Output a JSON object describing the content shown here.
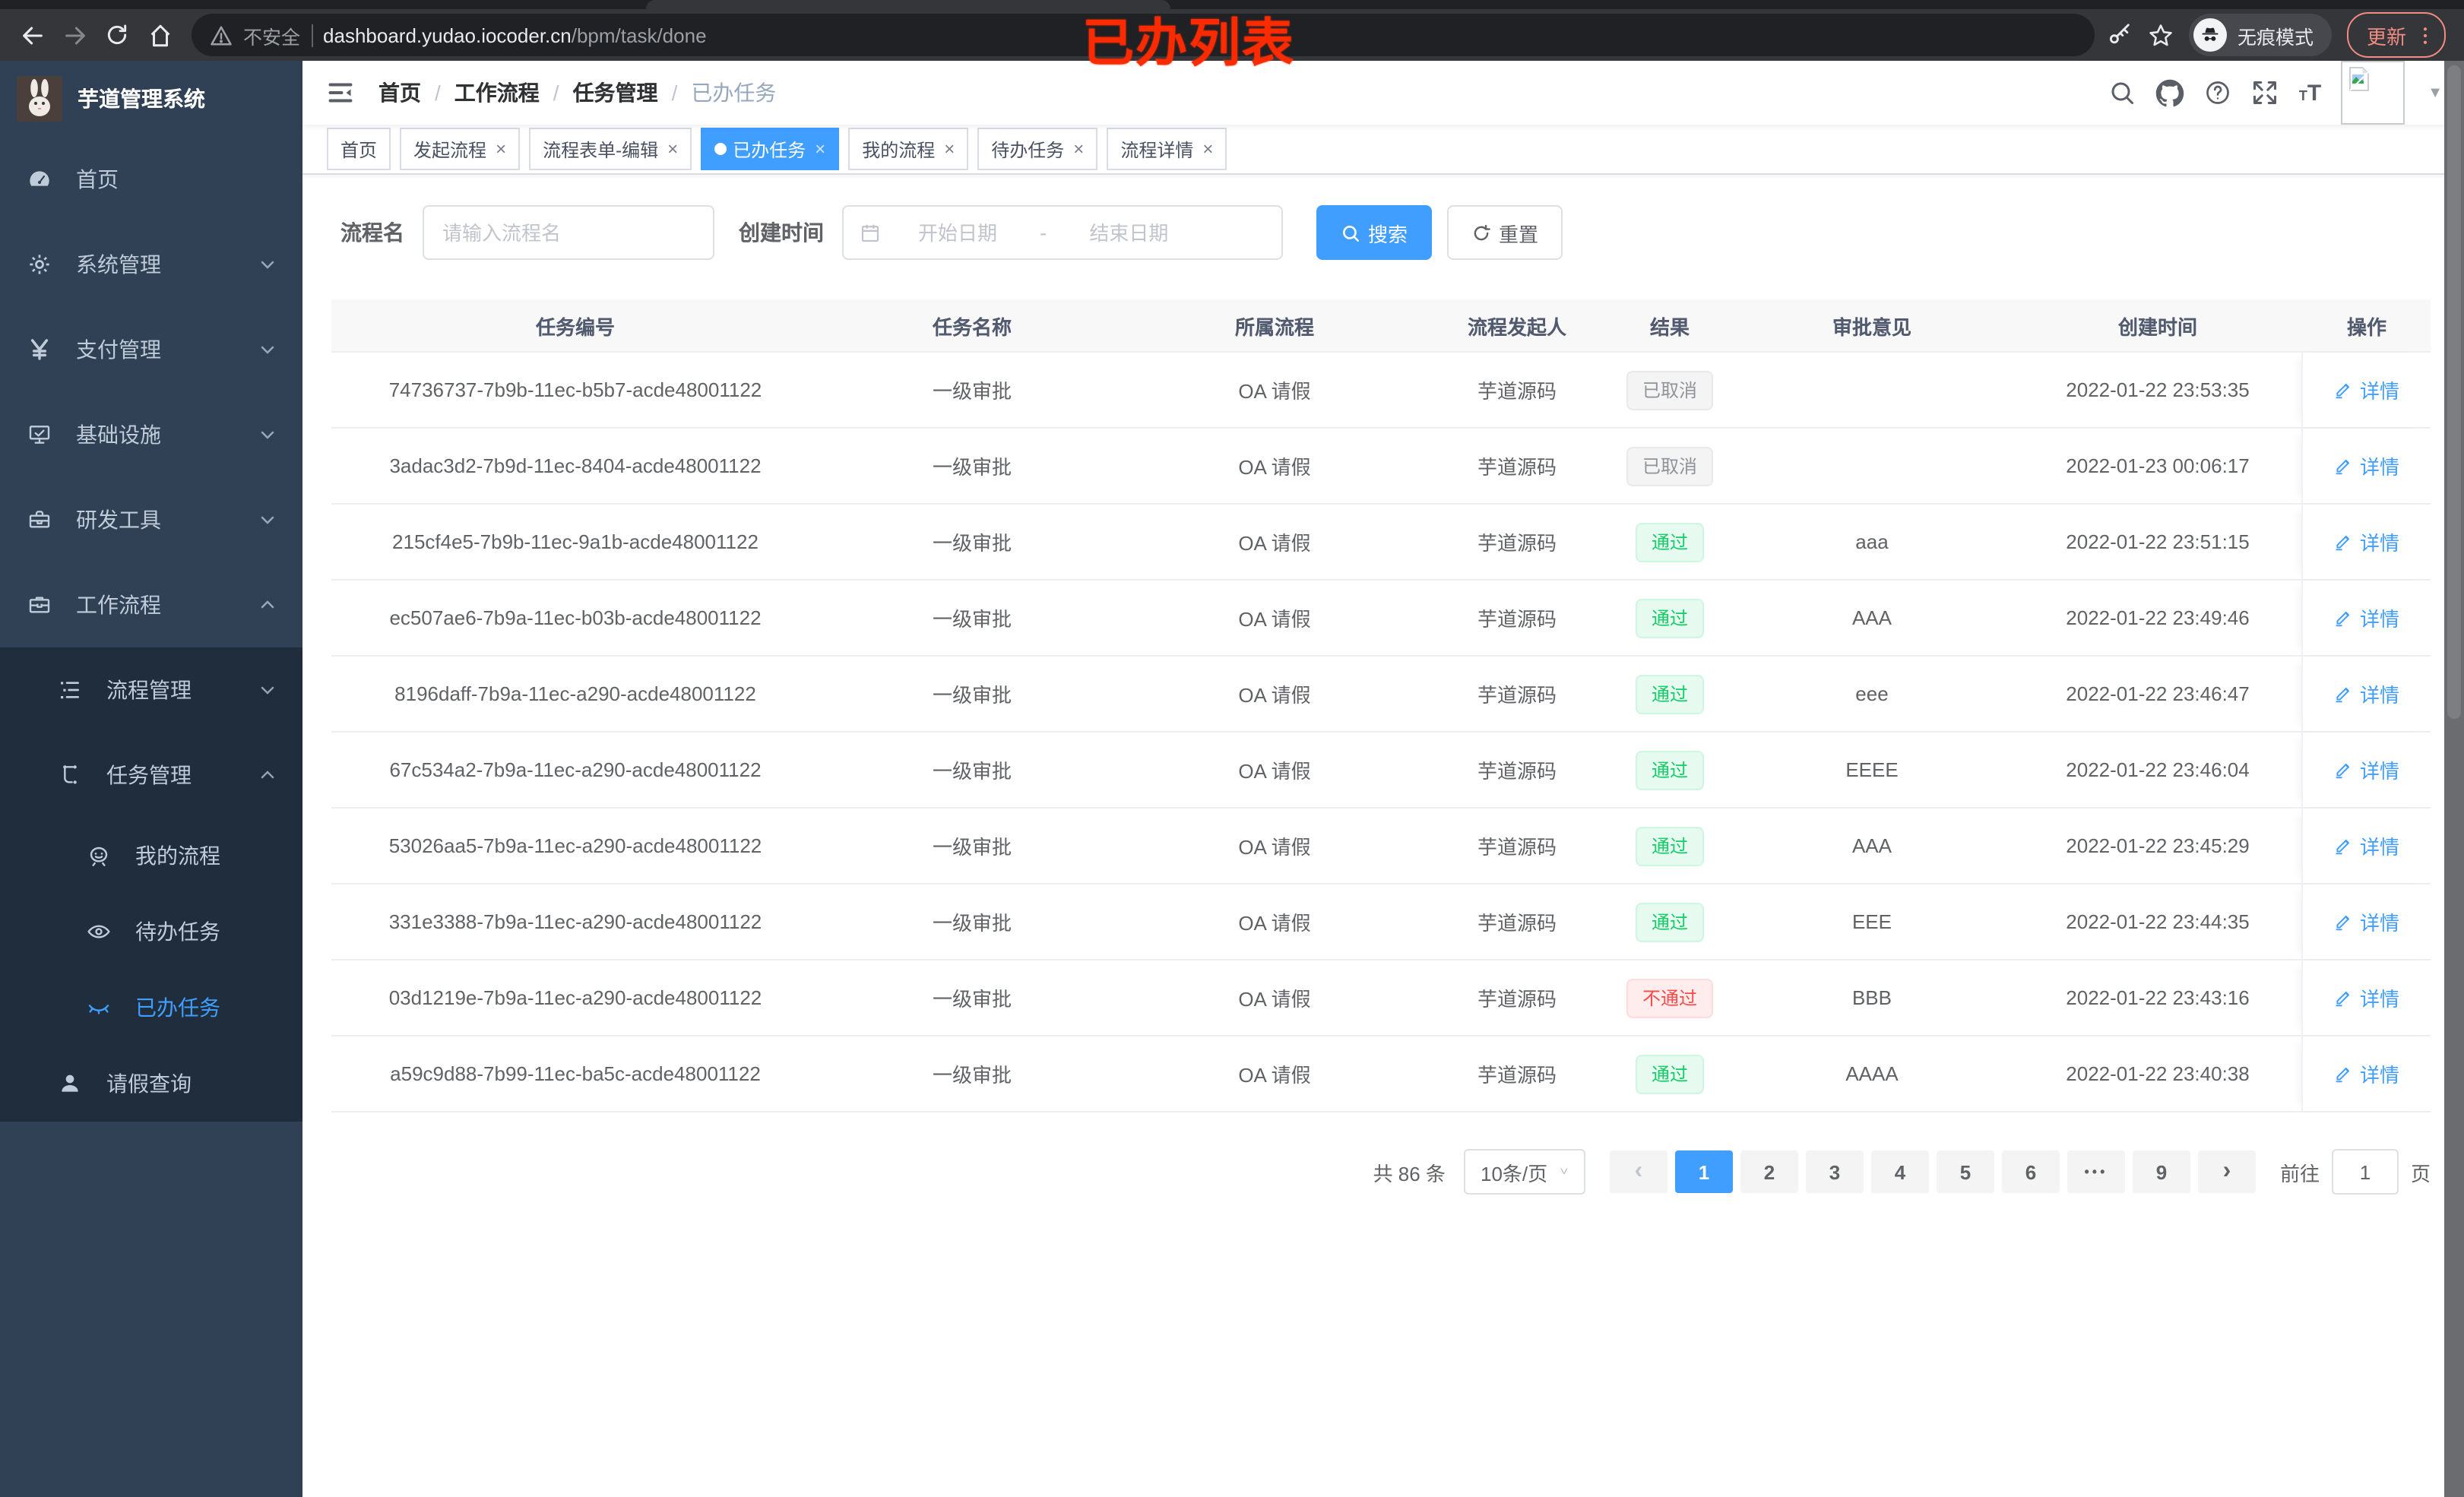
{
  "annotation": {
    "text": "已办列表",
    "color": "#fb2b01"
  },
  "browser": {
    "insecure_label": "不安全",
    "url_host": "dashboard.yudao.iocoder.cn",
    "url_path": "/bpm/task/done",
    "incognito_label": "无痕模式",
    "update_label": "更新",
    "icons": [
      "back-icon",
      "forward-icon",
      "reload-icon",
      "home-icon",
      "warning-icon",
      "key-icon",
      "star-icon",
      "incognito-icon",
      "more-vert-icon"
    ]
  },
  "sidebar": {
    "title": "芋道管理系统",
    "items": [
      {
        "label": "首页",
        "icon": "dashboard-icon"
      },
      {
        "label": "系统管理",
        "icon": "gear-icon",
        "expandable": true
      },
      {
        "label": "支付管理",
        "icon": "yen-icon",
        "expandable": true
      },
      {
        "label": "基础设施",
        "icon": "monitor-icon",
        "expandable": true
      },
      {
        "label": "研发工具",
        "icon": "toolbox-icon",
        "expandable": true
      },
      {
        "label": "工作流程",
        "icon": "briefcase-icon",
        "expandable": true,
        "expanded": true
      },
      {
        "label": "流程管理",
        "icon": "tree-icon",
        "expandable": true
      },
      {
        "label": "任务管理",
        "icon": "flow-icon",
        "expandable": true,
        "expanded": true
      },
      {
        "label": "我的流程",
        "icon": "robot-icon"
      },
      {
        "label": "待办任务",
        "icon": "eye-open-icon"
      },
      {
        "label": "已办任务",
        "icon": "eye-closed-icon",
        "active": true
      },
      {
        "label": "请假查询",
        "icon": "user-icon"
      }
    ]
  },
  "header": {
    "breadcrumb": [
      "首页",
      "工作流程",
      "任务管理",
      "已办任务"
    ],
    "right_icons": [
      "search-icon",
      "github-icon",
      "help-icon",
      "fullscreen-icon",
      "font-size-icon",
      "avatar",
      "chevron-down-icon"
    ]
  },
  "tabs": [
    {
      "label": "首页",
      "closable": false,
      "active": false
    },
    {
      "label": "发起流程",
      "closable": true,
      "active": false
    },
    {
      "label": "流程表单-编辑",
      "closable": true,
      "active": false
    },
    {
      "label": "已办任务",
      "closable": true,
      "active": true
    },
    {
      "label": "我的流程",
      "closable": true,
      "active": false
    },
    {
      "label": "待办任务",
      "closable": true,
      "active": false
    },
    {
      "label": "流程详情",
      "closable": true,
      "active": false
    }
  ],
  "filter": {
    "name_label": "流程名",
    "name_placeholder": "请输入流程名",
    "time_label": "创建时间",
    "start_placeholder": "开始日期",
    "range_separator": "-",
    "end_placeholder": "结束日期",
    "search_label": "搜索",
    "reset_label": "重置"
  },
  "table": {
    "columns": [
      "任务编号",
      "任务名称",
      "所属流程",
      "流程发起人",
      "结果",
      "审批意见",
      "创建时间",
      "操作"
    ],
    "detail_label": "详情",
    "rows": [
      {
        "id": "74736737-7b9b-11ec-b5b7-acde48001122",
        "name": "一级审批",
        "process": "OA 请假",
        "starter": "芋道源码",
        "result": "已取消",
        "result_type": "info",
        "opinion": "",
        "created": "2022-01-22 23:53:35"
      },
      {
        "id": "3adac3d2-7b9d-11ec-8404-acde48001122",
        "name": "一级审批",
        "process": "OA 请假",
        "starter": "芋道源码",
        "result": "已取消",
        "result_type": "info",
        "opinion": "",
        "created": "2022-01-23 00:06:17"
      },
      {
        "id": "215cf4e5-7b9b-11ec-9a1b-acde48001122",
        "name": "一级审批",
        "process": "OA 请假",
        "starter": "芋道源码",
        "result": "通过",
        "result_type": "success",
        "opinion": "aaa",
        "created": "2022-01-22 23:51:15"
      },
      {
        "id": "ec507ae6-7b9a-11ec-b03b-acde48001122",
        "name": "一级审批",
        "process": "OA 请假",
        "starter": "芋道源码",
        "result": "通过",
        "result_type": "success",
        "opinion": "AAA",
        "created": "2022-01-22 23:49:46"
      },
      {
        "id": "8196daff-7b9a-11ec-a290-acde48001122",
        "name": "一级审批",
        "process": "OA 请假",
        "starter": "芋道源码",
        "result": "通过",
        "result_type": "success",
        "opinion": "eee",
        "created": "2022-01-22 23:46:47"
      },
      {
        "id": "67c534a2-7b9a-11ec-a290-acde48001122",
        "name": "一级审批",
        "process": "OA 请假",
        "starter": "芋道源码",
        "result": "通过",
        "result_type": "success",
        "opinion": "EEEE",
        "created": "2022-01-22 23:46:04"
      },
      {
        "id": "53026aa5-7b9a-11ec-a290-acde48001122",
        "name": "一级审批",
        "process": "OA 请假",
        "starter": "芋道源码",
        "result": "通过",
        "result_type": "success",
        "opinion": "AAA",
        "created": "2022-01-22 23:45:29"
      },
      {
        "id": "331e3388-7b9a-11ec-a290-acde48001122",
        "name": "一级审批",
        "process": "OA 请假",
        "starter": "芋道源码",
        "result": "通过",
        "result_type": "success",
        "opinion": "EEE",
        "created": "2022-01-22 23:44:35"
      },
      {
        "id": "03d1219e-7b9a-11ec-a290-acde48001122",
        "name": "一级审批",
        "process": "OA 请假",
        "starter": "芋道源码",
        "result": "不通过",
        "result_type": "danger",
        "opinion": "BBB",
        "created": "2022-01-22 23:43:16"
      },
      {
        "id": "a59c9d88-7b99-11ec-ba5c-acde48001122",
        "name": "一级审批",
        "process": "OA 请假",
        "starter": "芋道源码",
        "result": "通过",
        "result_type": "success",
        "opinion": "AAAA",
        "created": "2022-01-22 23:40:38"
      }
    ]
  },
  "pagination": {
    "total_label": "共 86 条",
    "page_size_label": "10条/页",
    "pages": [
      {
        "label": "1",
        "active": true
      },
      {
        "label": "2"
      },
      {
        "label": "3"
      },
      {
        "label": "4"
      },
      {
        "label": "5"
      },
      {
        "label": "6"
      },
      {
        "label": "•••",
        "ellipsis": true
      },
      {
        "label": "9"
      }
    ],
    "goto_label": "前往",
    "goto_value": "1",
    "page_unit": "页"
  },
  "colors": {
    "accent": "#409eff",
    "sidebar_bg": "#304156",
    "submenu_bg": "#1f2d3d",
    "success_text": "#13ce66",
    "danger_text": "#ff4949",
    "info_text": "#909399",
    "annotation_red": "#fb2b01"
  }
}
